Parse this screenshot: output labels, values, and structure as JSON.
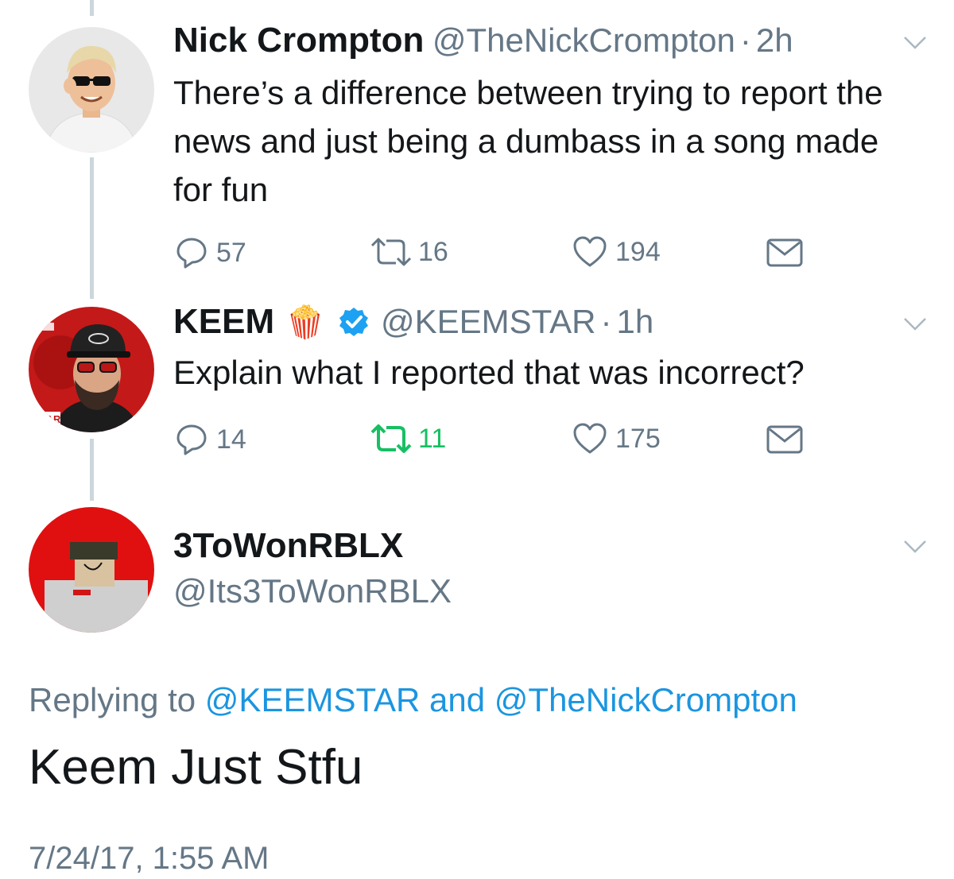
{
  "tweets": [
    {
      "name": "Nick Crompton",
      "handle": "@TheNickCrompton",
      "separator": "·",
      "time": "2h",
      "text": "There’s a difference between trying to report the news and just being a dumbass in a song made for fun",
      "replies": "57",
      "retweets": "16",
      "likes": "194"
    },
    {
      "name": "KEEM",
      "name_emoji": "🍿",
      "verified": true,
      "handle": "@KEEMSTAR",
      "separator": "·",
      "time": "1h",
      "text": "Explain what I reported that was incorrect?",
      "replies": "14",
      "retweets": "11",
      "likes": "175",
      "retweeted": true,
      "avatar_text": "STAR"
    }
  ],
  "focused_tweet": {
    "name": "3ToWonRBLX",
    "handle": "@Its3ToWonRBLX",
    "replying_prefix": "Replying to",
    "replying_to_1": "@KEEMSTAR",
    "replying_and": "and",
    "replying_to_2": "@TheNickCrompton",
    "text": "Keem Just Stfu",
    "timestamp": "7/24/17, 1:55 AM"
  },
  "colors": {
    "text": "#14171a",
    "secondary": "#657786",
    "link": "#1b95e0",
    "retweet_active": "#17bf63",
    "verified": "#1da1f2",
    "thread_line": "#ccd6dd"
  }
}
